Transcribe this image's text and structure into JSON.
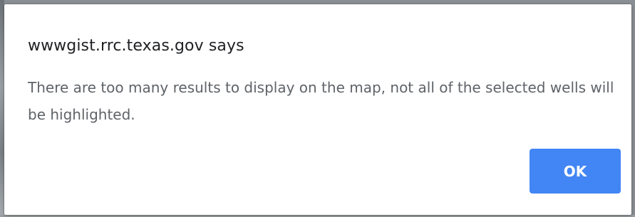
{
  "dialog": {
    "title": "wwwgist.rrc.texas.gov says",
    "message": "There are too many results to display on the map, not all of the selected wells will be highlighted.",
    "ok_label": "OK"
  },
  "colors": {
    "button_bg": "#4285f4",
    "button_text": "#ffffff",
    "title_text": "#202124",
    "message_text": "#5f6368"
  }
}
